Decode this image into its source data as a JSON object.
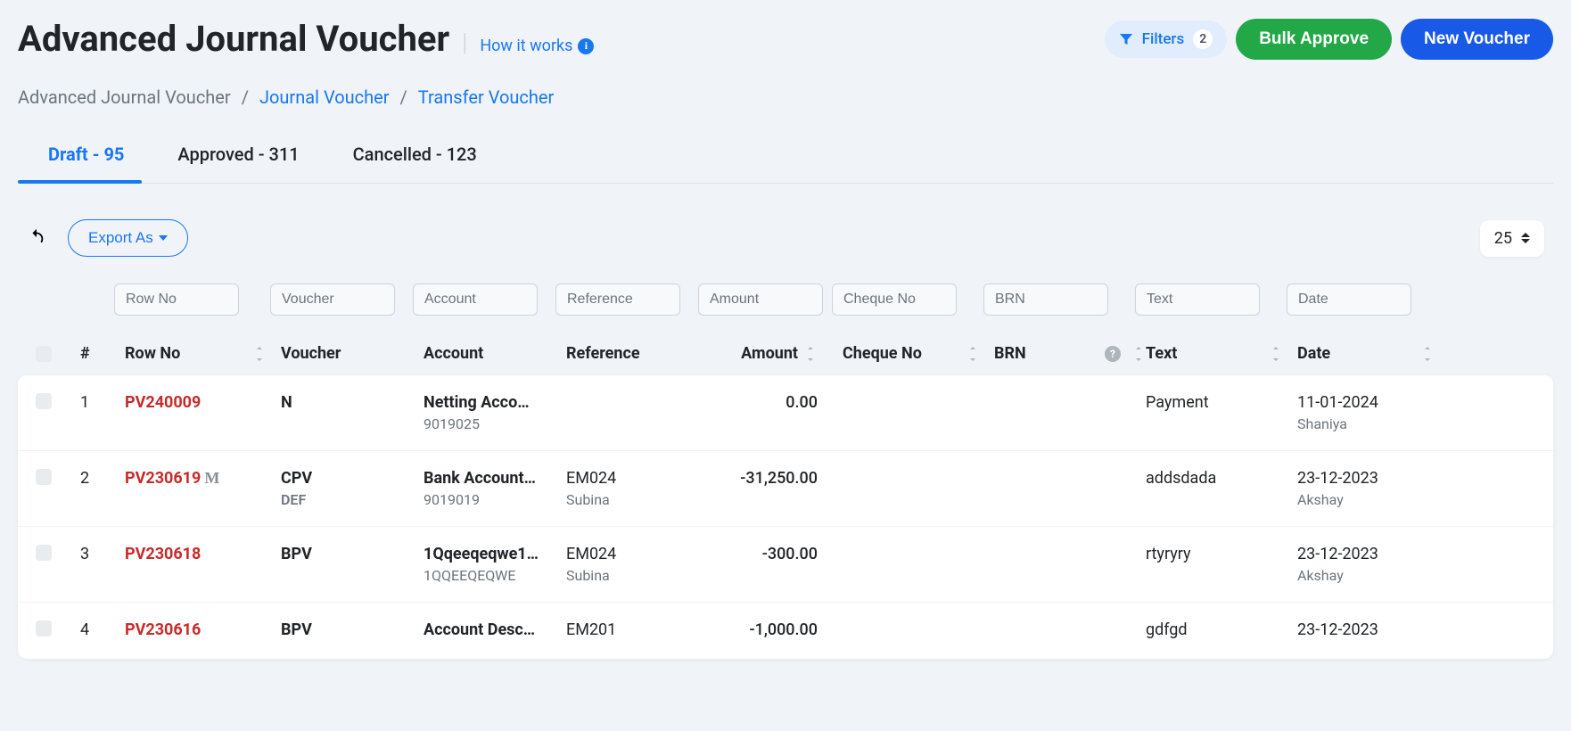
{
  "header": {
    "title": "Advanced Journal Voucher",
    "how_link": "How it works",
    "filters_label": "Filters",
    "filters_count": "2",
    "bulk_approve": "Bulk Approve",
    "new_voucher": "New Voucher"
  },
  "breadcrumb": {
    "current": "Advanced Journal Voucher",
    "items": [
      {
        "label": "Journal Voucher"
      },
      {
        "label": "Transfer Voucher"
      }
    ]
  },
  "tabs": [
    {
      "label": "Draft - 95",
      "active": true
    },
    {
      "label": "Approved - 311",
      "active": false
    },
    {
      "label": "Cancelled - 123",
      "active": false
    }
  ],
  "toolbar": {
    "export_label": "Export As",
    "page_size": "25"
  },
  "filters": {
    "row_no": "Row No",
    "voucher": "Voucher",
    "account": "Account",
    "reference": "Reference",
    "amount": "Amount",
    "cheque_no": "Cheque No",
    "brn": "BRN",
    "text": "Text",
    "date": "Date"
  },
  "columns": {
    "hash": "#",
    "row_no": "Row No",
    "voucher": "Voucher",
    "account": "Account",
    "reference": "Reference",
    "amount": "Amount",
    "cheque_no": "Cheque No",
    "brn": "BRN",
    "text": "Text",
    "date": "Date"
  },
  "rows": [
    {
      "idx": "1",
      "row_no": "PV240009",
      "m_badge": "",
      "voucher": "N",
      "voucher_sub": "",
      "account": "Netting Acco…",
      "account_sub": "9019025",
      "reference": "",
      "reference_sub": "",
      "amount": "0.00",
      "cheque_no": "",
      "brn": "",
      "text": "Payment",
      "date": "11-01-2024",
      "user": "Shaniya"
    },
    {
      "idx": "2",
      "row_no": "PV230619",
      "m_badge": "M",
      "voucher": "CPV",
      "voucher_sub": "DEF",
      "account": "Bank Account…",
      "account_sub": "9019019",
      "reference": "EM024",
      "reference_sub": "Subina",
      "amount": "-31,250.00",
      "cheque_no": "",
      "brn": "",
      "text": "addsdada",
      "date": "23-12-2023",
      "user": "Akshay"
    },
    {
      "idx": "3",
      "row_no": "PV230618",
      "m_badge": "",
      "voucher": "BPV",
      "voucher_sub": "",
      "account": "1Qqeeqeqwe1…",
      "account_sub": "1QQEEQEQWE",
      "reference": "EM024",
      "reference_sub": "Subina",
      "amount": "-300.00",
      "cheque_no": "",
      "brn": "",
      "text": "rtyryry",
      "date": "23-12-2023",
      "user": "Akshay"
    },
    {
      "idx": "4",
      "row_no": "PV230616",
      "m_badge": "",
      "voucher": "BPV",
      "voucher_sub": "",
      "account": "Account Desc…",
      "account_sub": "",
      "reference": "EM201",
      "reference_sub": "",
      "amount": "-1,000.00",
      "cheque_no": "",
      "brn": "",
      "text": "gdfgd",
      "date": "23-12-2023",
      "user": ""
    }
  ]
}
